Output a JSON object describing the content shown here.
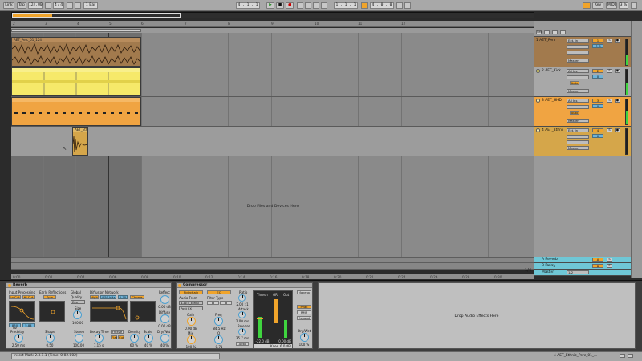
{
  "transport": {
    "link": "Link",
    "tap": "Tap",
    "tempo": "124.00",
    "time_sig": "4 / 4",
    "quantize": "1 Bar",
    "position": "4 . 1 . 1",
    "loop_start": "1 . 1 . 1",
    "loop_length": "4 . 0 . 0",
    "key": "Key",
    "midi": "MIDI",
    "cpu": "3 %"
  },
  "ruler": {
    "bars": [
      "2",
      "3",
      "4",
      "5",
      "6",
      "7",
      "8",
      "9",
      "10",
      "11",
      "12"
    ],
    "times": [
      "0:00",
      "0:02",
      "0:04",
      "0:06",
      "0:08",
      "0:10",
      "0:12",
      "0:14",
      "0:16",
      "0:18",
      "0:20",
      "0:22",
      "0:24",
      "0:26",
      "0:28",
      "0:30"
    ],
    "fraction": "1/4"
  },
  "tracks": [
    {
      "name": "1 AET_Perc",
      "input": "Ext. In",
      "channel": "1",
      "monitor": "In",
      "vol": "-1.6",
      "sends": [
        "0",
        "0"
      ],
      "output": "Master",
      "color": "#a27a4d",
      "clip": "AET_Perc_01_124"
    },
    {
      "name": "2 AET_Kick",
      "input": "All Ins",
      "channel": "2",
      "monitor": "In",
      "vol": "0",
      "sends": [
        "0",
        "0"
      ],
      "output": "Master",
      "color": "#f6e96a",
      "clip": ""
    },
    {
      "name": "3 AET_HHD",
      "input": "All Ins",
      "channel": "3",
      "monitor": "In",
      "vol": "0",
      "sends": [
        "0",
        "0"
      ],
      "output": "Master",
      "color": "#f0a442",
      "clip": ""
    },
    {
      "name": "4 AET_Ethni",
      "input": "Ext. In",
      "channel": "4",
      "monitor": "In",
      "vol": "0",
      "sends": [
        "0",
        "0"
      ],
      "output": "Master",
      "color": "#d5a64a",
      "clip": "AET_Ethn"
    }
  ],
  "returns": [
    {
      "name": "A Reverb",
      "num": "A",
      "color": "#6fc7d6"
    },
    {
      "name": "B Delay",
      "num": "B",
      "color": "#6fc7d6"
    },
    {
      "name": "Master",
      "num": "1/2",
      "color": "#6fc7d6"
    }
  ],
  "drop_files": "Drop Files and Devices Here",
  "drop_audio_effects": "Drop Audio Effects Here",
  "reverb": {
    "title": "Reverb",
    "input_processing": "Input Processing",
    "lo_cut": "Lo Cut",
    "hi_cut": "Hi Cut",
    "freq1": "830 Hz",
    "freq2": "5.84",
    "early_reflections": "Early Reflections",
    "spin": "Spin",
    "global": "Global",
    "quality": "Quality",
    "quality_val": "Eco",
    "size": "Size",
    "size_val": "100.00",
    "diffusion_network": "Diffusion Network",
    "high": "High",
    "high_freq": "4.50 kHz",
    "high_val": "0.70",
    "chorus": "Chorus",
    "reflect": "Reflect",
    "reflect_val": "0.00 dB",
    "diffuse": "Diffuse",
    "diffuse_val": "0.00 dB",
    "predelay": "Predelay",
    "predelay_val": "2.50 ms",
    "shape": "Shape",
    "shape_val": "0.50",
    "stereo": "Stereo",
    "stereo_val": "100.00",
    "decay_time": "Decay Time",
    "decay_val": "7.15 s",
    "freeze": "Freeze",
    "flat": "Flat",
    "cut": "Cut",
    "density": "Density",
    "density_val": "60 %",
    "scale": "Scale",
    "scale_val": "40 %",
    "drywet": "Dry/Wet",
    "drywet_val": "40 %"
  },
  "compressor": {
    "title": "Compressor",
    "sidechain": "Sidechain",
    "eq": "EQ",
    "audio_from": "Audio From",
    "audio_from_val": "4-AET_Ethni",
    "post_fx": "Post FX",
    "gain": "Gain",
    "gain_val": "0.00 dB",
    "mix": "Mix",
    "mix_val": "100 %",
    "filter_type": "Filter Type",
    "freq": "Freq",
    "freq_val": "84.5 Hz",
    "q": "Q",
    "q_val": "0.71",
    "ratio": "Ratio",
    "ratio_val": "2.00 : 1",
    "attack": "Attack",
    "attack_val": "2.00 ms",
    "release": "Release",
    "release_val": "35.7 ms",
    "auto": "Auto",
    "thresh": "Thresh",
    "gr": "GR",
    "out": "Out",
    "thresh_val": "-22.0 dB",
    "out_val": "0.00 dB",
    "knee": "Knee",
    "knee_val": "6.0 dB",
    "makeup": "Makeup",
    "peak": "Peak",
    "rms": "RMS",
    "expand": "Expand",
    "drywet": "Dry/Wet",
    "drywet_val": "100 %"
  },
  "status": {
    "left": "Insert Mark 2.3.1.1 (Time: 0:02.002)",
    "right_track": "4-AET_Ethnic_Perc_01_..."
  }
}
